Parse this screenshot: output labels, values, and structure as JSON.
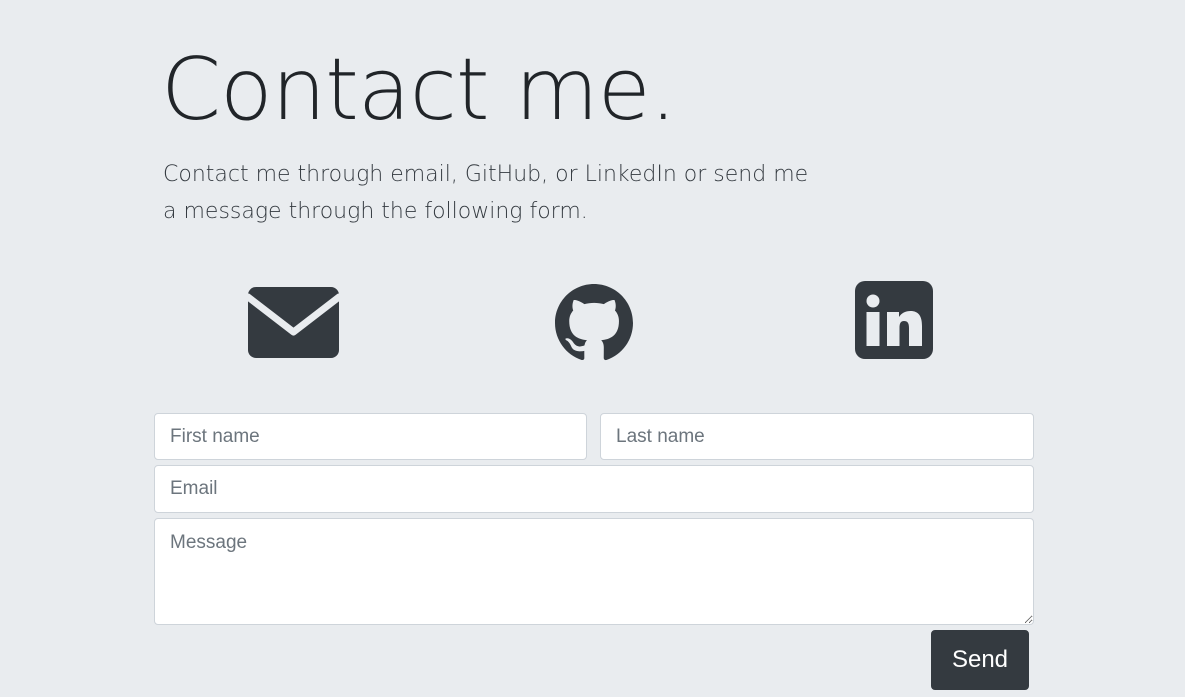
{
  "header": {
    "title": "Contact me.",
    "lead": "Contact me through email, GitHub, or LinkedIn or send me a message through the following form."
  },
  "contact_links": [
    {
      "name": "email",
      "icon": "envelope-icon"
    },
    {
      "name": "github",
      "icon": "github-icon"
    },
    {
      "name": "linkedin",
      "icon": "linkedin-icon"
    }
  ],
  "form": {
    "first_name_placeholder": "First name",
    "last_name_placeholder": "Last name",
    "email_placeholder": "Email",
    "message_placeholder": "Message",
    "send_label": "Send"
  },
  "colors": {
    "background": "#e9ecef",
    "icon": "#343a40",
    "button": "#343a40",
    "text": "#212529"
  }
}
